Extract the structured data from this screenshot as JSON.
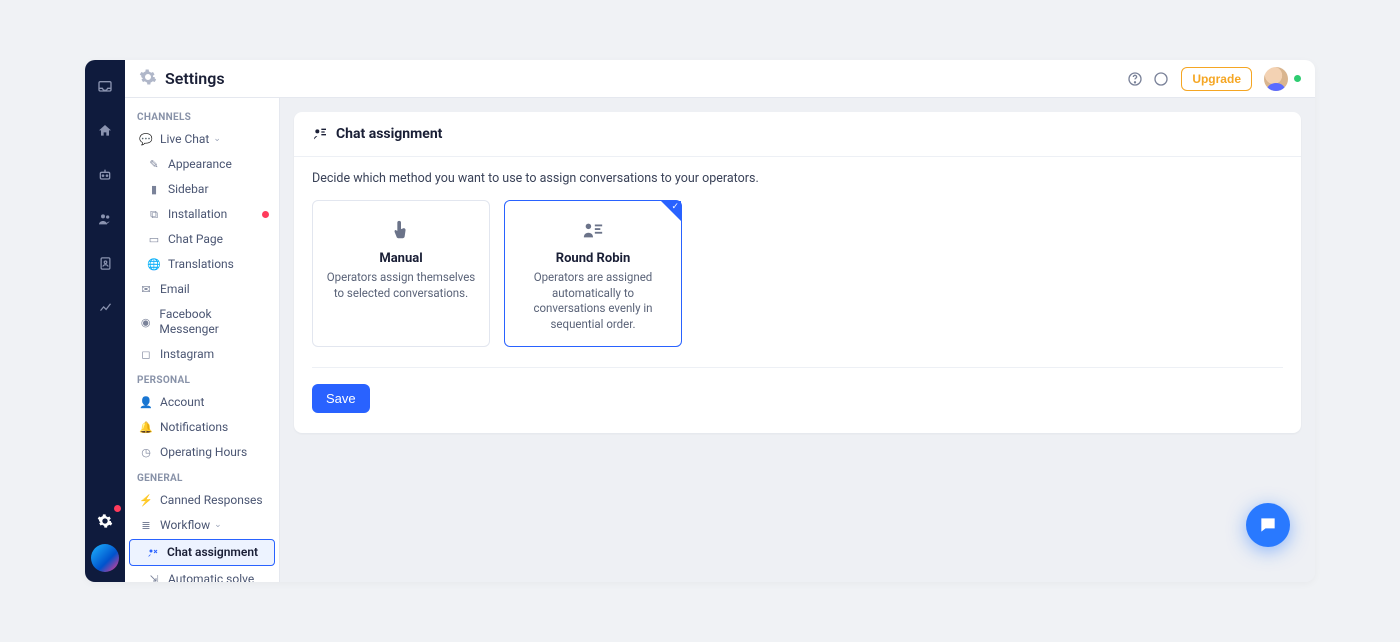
{
  "header": {
    "title": "Settings",
    "upgrade_label": "Upgrade"
  },
  "sidebar": {
    "sections": [
      {
        "key": "channels",
        "label": "CHANNELS",
        "items": [
          {
            "label": "Live Chat",
            "expandable": true
          },
          {
            "label": "Appearance",
            "sub": true
          },
          {
            "label": "Sidebar",
            "sub": true
          },
          {
            "label": "Installation",
            "sub": true,
            "badge": true
          },
          {
            "label": "Chat Page",
            "sub": true
          },
          {
            "label": "Translations",
            "sub": true
          },
          {
            "label": "Email"
          },
          {
            "label": "Facebook Messenger"
          },
          {
            "label": "Instagram"
          }
        ]
      },
      {
        "key": "personal",
        "label": "PERSONAL",
        "items": [
          {
            "label": "Account"
          },
          {
            "label": "Notifications"
          },
          {
            "label": "Operating Hours"
          }
        ]
      },
      {
        "key": "general",
        "label": "GENERAL",
        "items": [
          {
            "label": "Canned Responses"
          },
          {
            "label": "Workflow",
            "expandable": true
          },
          {
            "label": "Chat assignment",
            "sub": true,
            "active": true
          },
          {
            "label": "Automatic solve",
            "sub": true
          }
        ]
      }
    ]
  },
  "main": {
    "title": "Chat assignment",
    "description": "Decide which method you want to use to assign conversations to your operators.",
    "options": [
      {
        "key": "manual",
        "title": "Manual",
        "description": "Operators assign themselves to selected conversations.",
        "selected": false
      },
      {
        "key": "round_robin",
        "title": "Round Robin",
        "description": "Operators are assigned automatically to conversations evenly in sequential order.",
        "selected": true
      }
    ],
    "save_label": "Save"
  }
}
